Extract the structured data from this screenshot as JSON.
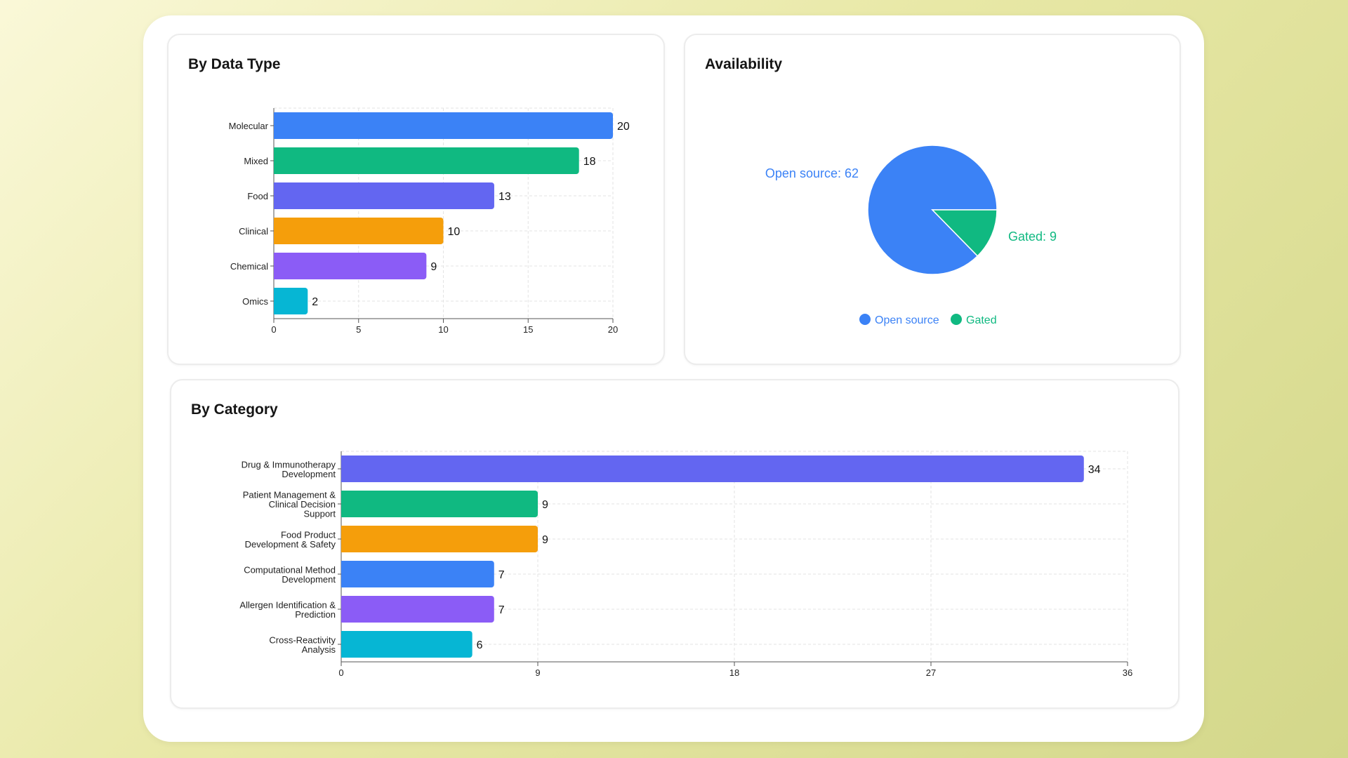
{
  "charts": {
    "data_type": {
      "title": "By Data Type"
    },
    "availability": {
      "title": "Availability"
    },
    "category": {
      "title": "By Category"
    }
  },
  "chart_data": [
    {
      "type": "bar",
      "orientation": "horizontal",
      "title": "By Data Type",
      "categories": [
        "Molecular",
        "Mixed",
        "Food",
        "Clinical",
        "Chemical",
        "Omics"
      ],
      "values": [
        20,
        18,
        13,
        10,
        9,
        2
      ],
      "colors": [
        "#3b82f6",
        "#10b981",
        "#6366f1",
        "#f59e0b",
        "#8b5cf6",
        "#06b6d4"
      ],
      "xlim": [
        0,
        20
      ],
      "xticks": [
        0,
        5,
        10,
        15,
        20
      ],
      "grid": true
    },
    {
      "type": "pie",
      "title": "Availability",
      "labels": [
        "Open source",
        "Gated"
      ],
      "values": [
        62,
        9
      ],
      "slice_labels": [
        "Open source: 62",
        "Gated: 9"
      ],
      "colors": [
        "#3b82f6",
        "#10b981"
      ],
      "legend": "bottom"
    },
    {
      "type": "bar",
      "orientation": "horizontal",
      "title": "By Category",
      "categories": [
        [
          "Drug & Immunotherapy",
          "Development"
        ],
        [
          "Patient Management &",
          "Clinical Decision",
          "Support"
        ],
        [
          "Food Product",
          "Development & Safety"
        ],
        [
          "Computational Method",
          "Development"
        ],
        [
          "Allergen Identification &",
          "Prediction"
        ],
        [
          "Cross-Reactivity",
          "Analysis"
        ]
      ],
      "values": [
        34,
        9,
        9,
        7,
        7,
        6
      ],
      "colors": [
        "#6366f1",
        "#10b981",
        "#f59e0b",
        "#3b82f6",
        "#8b5cf6",
        "#06b6d4"
      ],
      "xlim": [
        0,
        36
      ],
      "xticks": [
        0,
        9,
        18,
        27,
        36
      ],
      "grid": true
    }
  ]
}
